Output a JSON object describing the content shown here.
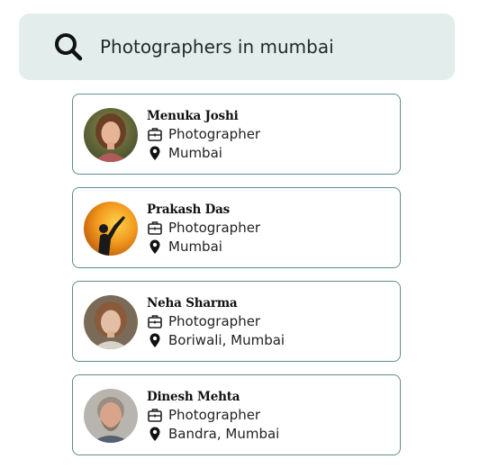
{
  "search": {
    "query": "Photographers in mumbai",
    "icon": "search-icon"
  },
  "results": [
    {
      "name": "Menuka Joshi",
      "profession": "Photographer",
      "location": "Mumbai"
    },
    {
      "name": "Prakash Das",
      "profession": "Photographer",
      "location": "Mumbai"
    },
    {
      "name": "Neha Sharma",
      "profession": "Photographer",
      "location": "Boriwali, Mumbai"
    },
    {
      "name": "Dinesh Mehta",
      "profession": "Photographer",
      "location": "Bandra, Mumbai"
    }
  ],
  "colors": {
    "search_bg": "#e3eeec",
    "card_border": "#5e8f8a"
  }
}
